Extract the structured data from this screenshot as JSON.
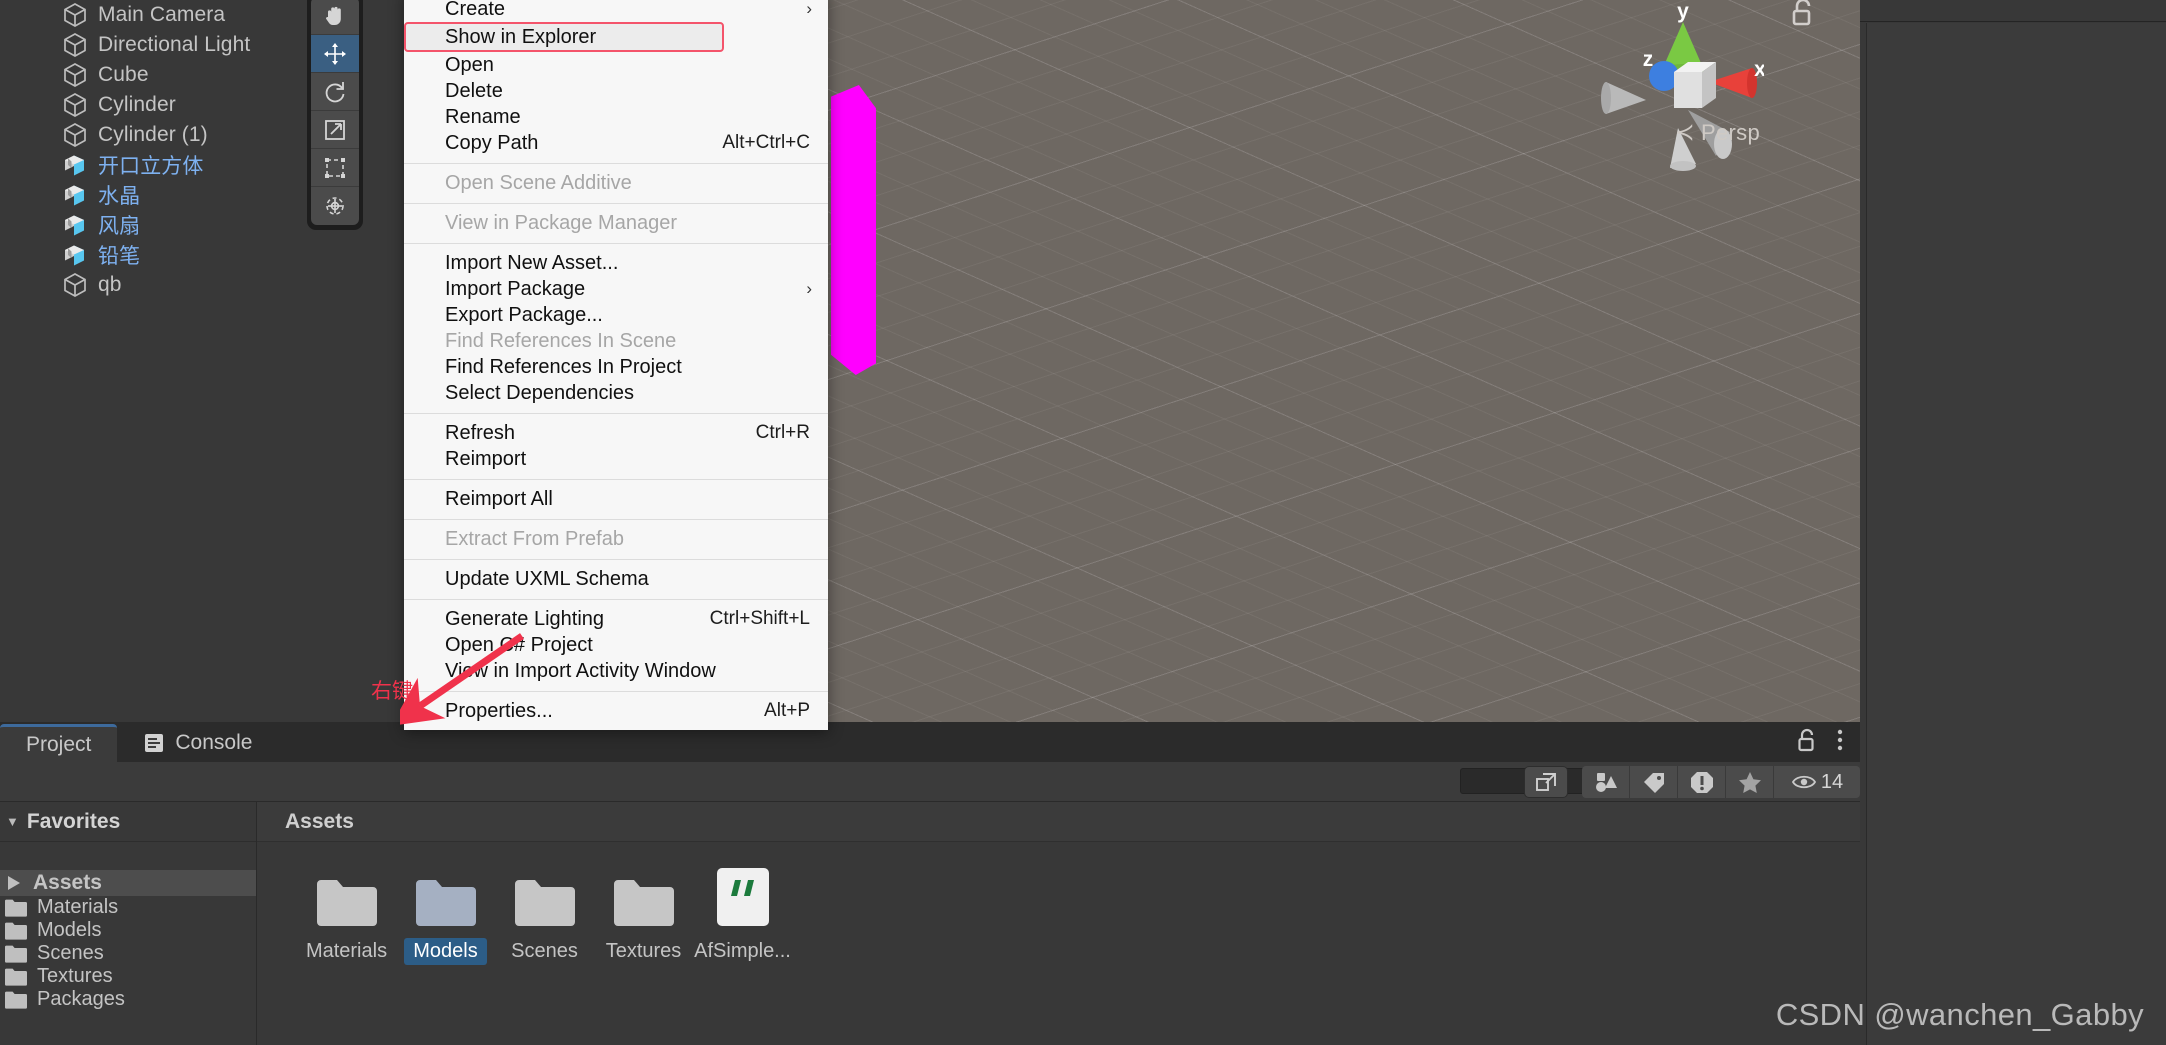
{
  "hierarchy": {
    "items": [
      {
        "label": "Main Camera",
        "type": "gameobject"
      },
      {
        "label": "Directional Light",
        "type": "gameobject"
      },
      {
        "label": "Cube",
        "type": "gameobject"
      },
      {
        "label": "Cylinder",
        "type": "gameobject"
      },
      {
        "label": "Cylinder (1)",
        "type": "gameobject"
      },
      {
        "label": "开口立方体",
        "type": "prefab"
      },
      {
        "label": "水晶",
        "type": "prefab"
      },
      {
        "label": "风扇",
        "type": "prefab"
      },
      {
        "label": "铅笔",
        "type": "prefab"
      },
      {
        "label": "qb",
        "type": "gameobject"
      }
    ]
  },
  "scene": {
    "gizmo": {
      "x_label": "x",
      "y_label": "y",
      "z_label": "z"
    },
    "perspective_label": "Persp",
    "tools": [
      {
        "name": "hand-tool",
        "active": false
      },
      {
        "name": "move-tool",
        "active": true
      },
      {
        "name": "rotate-tool",
        "active": false
      },
      {
        "name": "scale-tool",
        "active": false
      },
      {
        "name": "rect-tool",
        "active": false
      },
      {
        "name": "transform-tool",
        "active": false
      }
    ]
  },
  "context_menu": {
    "items": [
      {
        "label": "Create",
        "shortcut": "",
        "submenu": true,
        "disabled": false,
        "highlight": false
      },
      {
        "label": "Show in Explorer",
        "shortcut": "",
        "submenu": false,
        "disabled": false,
        "highlight": true
      },
      {
        "label": "Open",
        "shortcut": "",
        "submenu": false,
        "disabled": false,
        "highlight": false
      },
      {
        "label": "Delete",
        "shortcut": "",
        "submenu": false,
        "disabled": false,
        "highlight": false
      },
      {
        "label": "Rename",
        "shortcut": "",
        "submenu": false,
        "disabled": false,
        "highlight": false
      },
      {
        "label": "Copy Path",
        "shortcut": "Alt+Ctrl+C",
        "submenu": false,
        "disabled": false,
        "highlight": false
      },
      {
        "separator": true
      },
      {
        "label": "Open Scene Additive",
        "shortcut": "",
        "submenu": false,
        "disabled": true,
        "highlight": false
      },
      {
        "separator": true
      },
      {
        "label": "View in Package Manager",
        "shortcut": "",
        "submenu": false,
        "disabled": true,
        "highlight": false
      },
      {
        "separator": true
      },
      {
        "label": "Import New Asset...",
        "shortcut": "",
        "submenu": false,
        "disabled": false,
        "highlight": false
      },
      {
        "label": "Import Package",
        "shortcut": "",
        "submenu": true,
        "disabled": false,
        "highlight": false
      },
      {
        "label": "Export Package...",
        "shortcut": "",
        "submenu": false,
        "disabled": false,
        "highlight": false
      },
      {
        "label": "Find References In Scene",
        "shortcut": "",
        "submenu": false,
        "disabled": true,
        "highlight": false
      },
      {
        "label": "Find References In Project",
        "shortcut": "",
        "submenu": false,
        "disabled": false,
        "highlight": false
      },
      {
        "label": "Select Dependencies",
        "shortcut": "",
        "submenu": false,
        "disabled": false,
        "highlight": false
      },
      {
        "separator": true
      },
      {
        "label": "Refresh",
        "shortcut": "Ctrl+R",
        "submenu": false,
        "disabled": false,
        "highlight": false
      },
      {
        "label": "Reimport",
        "shortcut": "",
        "submenu": false,
        "disabled": false,
        "highlight": false
      },
      {
        "separator": true
      },
      {
        "label": "Reimport All",
        "shortcut": "",
        "submenu": false,
        "disabled": false,
        "highlight": false
      },
      {
        "separator": true
      },
      {
        "label": "Extract From Prefab",
        "shortcut": "",
        "submenu": false,
        "disabled": true,
        "highlight": false
      },
      {
        "separator": true
      },
      {
        "label": "Update UXML Schema",
        "shortcut": "",
        "submenu": false,
        "disabled": false,
        "highlight": false
      },
      {
        "separator": true
      },
      {
        "label": "Generate Lighting",
        "shortcut": "Ctrl+Shift+L",
        "submenu": false,
        "disabled": false,
        "highlight": false
      },
      {
        "label": "Open C# Project",
        "shortcut": "",
        "submenu": false,
        "disabled": false,
        "highlight": false
      },
      {
        "label": "View in Import Activity Window",
        "shortcut": "",
        "submenu": false,
        "disabled": false,
        "highlight": false
      },
      {
        "separator": true
      },
      {
        "label": "Properties...",
        "shortcut": "Alt+P",
        "submenu": false,
        "disabled": false,
        "highlight": false
      }
    ]
  },
  "project": {
    "tabs": [
      {
        "label": "Project",
        "active": true,
        "icon": ""
      },
      {
        "label": "Console",
        "active": false,
        "icon": "console-icon"
      }
    ],
    "tree": {
      "favorites_label": "Favorites",
      "rows": [
        {
          "label": "Assets",
          "type": "assets",
          "selected": true,
          "bold": true
        },
        {
          "label": "Materials",
          "type": "folder",
          "selected": false,
          "bold": false
        },
        {
          "label": "Models",
          "type": "folder",
          "selected": false,
          "bold": false
        },
        {
          "label": "Scenes",
          "type": "folder",
          "selected": false,
          "bold": false
        },
        {
          "label": "Textures",
          "type": "folder",
          "selected": false,
          "bold": false
        },
        {
          "label": "Packages",
          "type": "folder",
          "selected": false,
          "bold": false
        }
      ]
    },
    "content_header": "Assets",
    "assets": [
      {
        "label": "Materials",
        "type": "folder",
        "selected": false
      },
      {
        "label": "Models",
        "type": "folder",
        "selected": true
      },
      {
        "label": "Scenes",
        "type": "folder",
        "selected": false
      },
      {
        "label": "Textures",
        "type": "folder",
        "selected": false
      },
      {
        "label": "AfSimple...",
        "type": "script",
        "selected": false
      }
    ],
    "toolbar": {
      "visible_count": "14",
      "icons": [
        "expand-icon",
        "shapes-filter-icon",
        "label-icon",
        "warning-icon",
        "favorite-star-icon",
        "eye-icon"
      ]
    },
    "tabbar_icons": [
      "lock-icon",
      "more-options-icon"
    ]
  },
  "annotations": {
    "right_click_label": "右键",
    "watermark": "CSDN @wanchen_Gabby",
    "highlight_color": "#f4546b"
  }
}
